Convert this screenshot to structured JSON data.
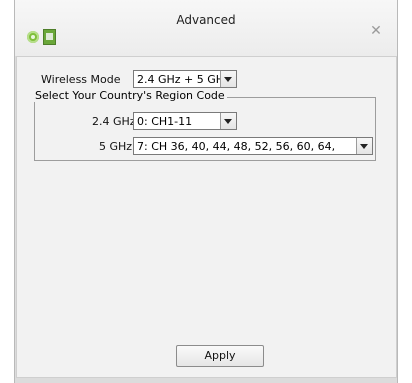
{
  "window": {
    "title": "Advanced",
    "close_glyph": "✕",
    "icons": [
      "settings-gear-icon",
      "document-icon",
      "close-icon"
    ]
  },
  "wireless_mode": {
    "label": "Wireless Mode",
    "value": "2.4 GHz + 5 GH:"
  },
  "region": {
    "legend": "Select Your Country's Region Code",
    "band_24": {
      "label": "2.4 GHz",
      "value": "0: CH1-11"
    },
    "band_5": {
      "label": "5 GHz",
      "value": "7:  CH  36,  40,  44,  48,  52,  56,  60,  64,"
    }
  },
  "apply_label": "Apply",
  "colors": {
    "chrome": "#dcdcdc",
    "panel": "#f2f2f2",
    "accent_green": "#6aa739"
  }
}
